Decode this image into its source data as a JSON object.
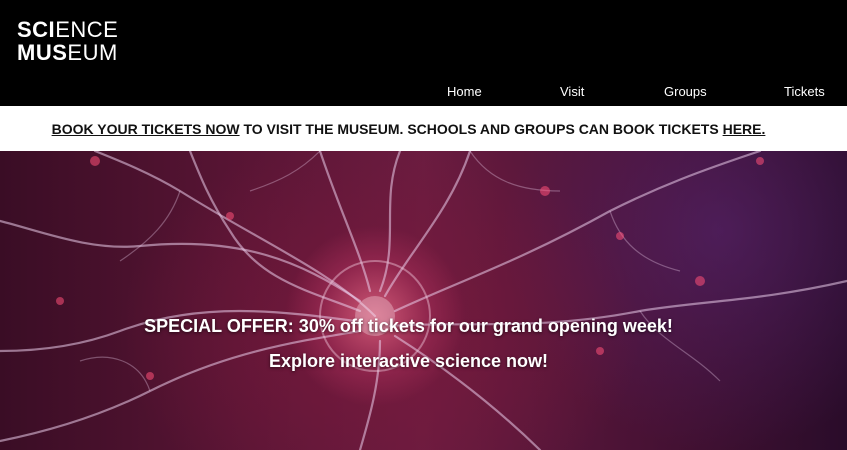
{
  "logo": {
    "line1_bold": "SCI",
    "line1_light": "ENCE",
    "line2_bold": "MUS",
    "line2_light": "EUM"
  },
  "nav": {
    "items": [
      "Home",
      "Visit",
      "Groups",
      "Tickets"
    ]
  },
  "banner": {
    "link1": "BOOK YOUR TICKETS NOW",
    "middle": " TO VISIT THE MUSEUM. SCHOOLS AND GROUPS CAN BOOK TICKETS ",
    "link2": "HERE."
  },
  "hero": {
    "offer": "SPECIAL OFFER: 30% off tickets for our grand opening week!",
    "cta": "Explore interactive science now!"
  }
}
